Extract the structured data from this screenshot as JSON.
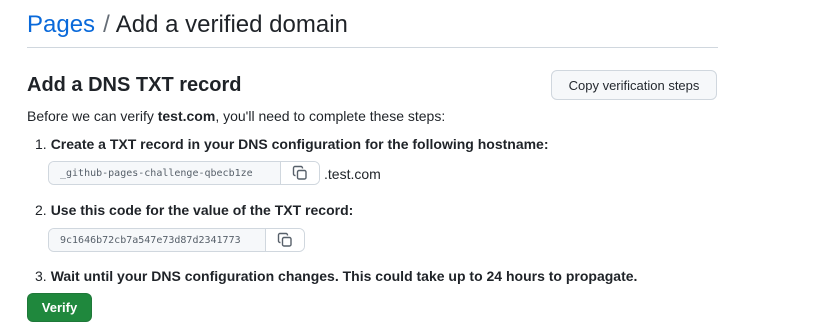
{
  "breadcrumb": {
    "parent": "Pages",
    "separator": "/",
    "current": "Add a verified domain"
  },
  "section": {
    "title": "Add a DNS TXT record",
    "copy_steps_label": "Copy verification steps"
  },
  "intro": {
    "prefix": "Before we can verify ",
    "domain": "test.com",
    "suffix": ", you'll need to complete these steps:"
  },
  "steps": [
    {
      "number": "1.",
      "text": "Create a TXT record in your DNS configuration for the following hostname:",
      "code": "_github-pages-challenge-qbecb1ze",
      "code_suffix": ".test.com"
    },
    {
      "number": "2.",
      "text": "Use this code for the value of the TXT record:",
      "code": "9c1646b72cb7a547e73d87d2341773"
    },
    {
      "number": "3.",
      "text": "Wait until your DNS configuration changes. This could take up to 24 hours to propagate."
    }
  ],
  "verify_label": "Verify",
  "icons": {
    "copy": "copy-icon"
  },
  "colors": {
    "link": "#0969da",
    "primary_button": "#1f883d",
    "border": "#d0d7de"
  }
}
